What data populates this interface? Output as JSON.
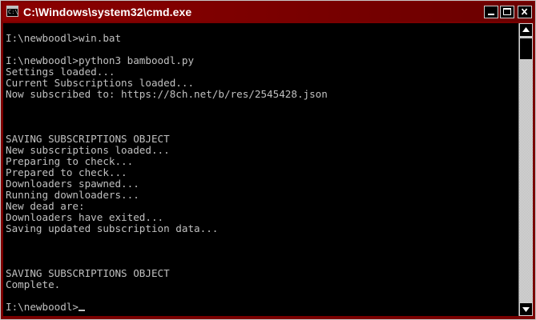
{
  "window": {
    "title": "C:\\Windows\\system32\\cmd.exe",
    "icon_label": "C:\\",
    "titlebar_color": "#7d0000",
    "title_color": "#ffffff"
  },
  "titlebar_buttons": {
    "minimize_icon": "minimize-icon",
    "maximize_icon": "maximize-icon",
    "close_icon": "close-icon"
  },
  "console": {
    "background": "#000000",
    "foreground": "#c0c0c0",
    "lines": [
      "I:\\newboodl>win.bat",
      "",
      "I:\\newboodl>python3 bamboodl.py",
      "Settings loaded...",
      "Current Subscriptions loaded...",
      "Now subscribed to: https://8ch.net/b/res/2545428.json",
      "",
      "",
      "",
      "SAVING SUBSCRIPTIONS OBJECT",
      "New subscriptions loaded...",
      "Preparing to check...",
      "Prepared to check...",
      "Downloaders spawned...",
      "Running downloaders...",
      "New dead are:",
      "Downloaders have exited...",
      "Saving updated subscription data...",
      "",
      "",
      "",
      "SAVING SUBSCRIPTIONS OBJECT",
      "Complete.",
      "",
      "I:\\newboodl>"
    ]
  },
  "scrollbar": {
    "up_icon": "scroll-up-arrow-icon",
    "down_icon": "scroll-down-arrow-icon",
    "position": 0.0
  }
}
